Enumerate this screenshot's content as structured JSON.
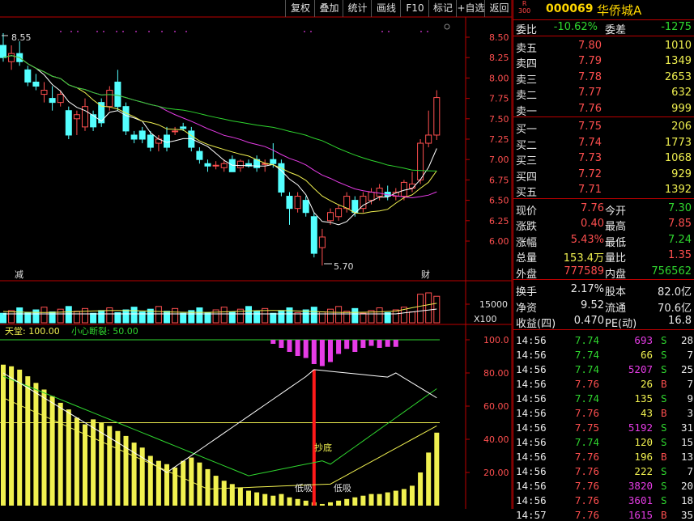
{
  "toolbar": {
    "buttons": [
      "复权",
      "叠加",
      "统计",
      "画线",
      "F10",
      "标记",
      "+自选",
      "返回"
    ]
  },
  "stock": {
    "badge_r": "R",
    "badge_300": "300",
    "code": "000069",
    "name": "华侨城A"
  },
  "price_chart": {
    "y_ticks": [
      "8.50",
      "8.25",
      "8.00",
      "7.75",
      "7.50",
      "7.25",
      "7.00",
      "6.75",
      "6.50",
      "6.25",
      "6.00"
    ],
    "high_label": "8.55",
    "low_label": "5.70",
    "marker_left": "减",
    "marker_right": "财",
    "ylim": [
      5.7,
      8.55
    ]
  },
  "volume_chart": {
    "tick": "15000",
    "unit": "X100"
  },
  "indicator": {
    "legend_a": "天堂: 100.00",
    "legend_b": "小心断裂: 50.00",
    "y_ticks": [
      "100.0",
      "80.00",
      "60.00",
      "40.00",
      "20.00"
    ],
    "label_bottom": "抄底",
    "label_low1": "低吸",
    "label_low2": "低吸"
  },
  "chart_data": {
    "type": "candlestick",
    "title": "",
    "ylim": [
      5.7,
      8.55
    ],
    "candles": [
      {
        "o": 8.4,
        "h": 8.55,
        "l": 8.2,
        "c": 8.25
      },
      {
        "o": 8.2,
        "h": 8.4,
        "l": 8.1,
        "c": 8.3
      },
      {
        "o": 8.3,
        "h": 8.45,
        "l": 8.15,
        "c": 8.2
      },
      {
        "o": 8.1,
        "h": 8.15,
        "l": 7.9,
        "c": 7.95
      },
      {
        "o": 7.95,
        "h": 8.05,
        "l": 7.85,
        "c": 7.9
      },
      {
        "o": 7.8,
        "h": 7.95,
        "l": 7.7,
        "c": 7.85
      },
      {
        "o": 7.75,
        "h": 7.9,
        "l": 7.6,
        "c": 7.7
      },
      {
        "o": 7.7,
        "h": 7.85,
        "l": 7.65,
        "c": 7.8
      },
      {
        "o": 7.6,
        "h": 7.65,
        "l": 7.25,
        "c": 7.3
      },
      {
        "o": 7.5,
        "h": 7.6,
        "l": 7.3,
        "c": 7.55
      },
      {
        "o": 7.4,
        "h": 7.75,
        "l": 7.35,
        "c": 7.65
      },
      {
        "o": 7.55,
        "h": 7.6,
        "l": 7.35,
        "c": 7.4
      },
      {
        "o": 7.7,
        "h": 7.75,
        "l": 7.4,
        "c": 7.45
      },
      {
        "o": 7.65,
        "h": 7.9,
        "l": 7.6,
        "c": 7.85
      },
      {
        "o": 7.95,
        "h": 8.1,
        "l": 7.6,
        "c": 7.65
      },
      {
        "o": 7.65,
        "h": 7.7,
        "l": 7.3,
        "c": 7.35
      },
      {
        "o": 7.3,
        "h": 7.35,
        "l": 7.2,
        "c": 7.25
      },
      {
        "o": 7.35,
        "h": 7.4,
        "l": 7.2,
        "c": 7.25
      },
      {
        "o": 7.3,
        "h": 7.35,
        "l": 7.1,
        "c": 7.15
      },
      {
        "o": 7.2,
        "h": 7.3,
        "l": 7.1,
        "c": 7.25
      },
      {
        "o": 7.3,
        "h": 7.4,
        "l": 7.1,
        "c": 7.15
      },
      {
        "o": 7.35,
        "h": 7.4,
        "l": 7.3,
        "c": 7.35
      },
      {
        "o": 7.4,
        "h": 7.45,
        "l": 7.35,
        "c": 7.38
      },
      {
        "o": 7.35,
        "h": 7.4,
        "l": 7.1,
        "c": 7.15
      },
      {
        "o": 7.1,
        "h": 7.15,
        "l": 6.95,
        "c": 7.0
      },
      {
        "o": 6.95,
        "h": 7.0,
        "l": 6.85,
        "c": 6.92
      },
      {
        "o": 6.92,
        "h": 6.98,
        "l": 6.88,
        "c": 6.93
      },
      {
        "o": 6.9,
        "h": 7.0,
        "l": 6.85,
        "c": 6.95
      },
      {
        "o": 7.0,
        "h": 7.05,
        "l": 6.85,
        "c": 6.85
      },
      {
        "o": 6.9,
        "h": 7.0,
        "l": 6.85,
        "c": 6.98
      },
      {
        "o": 6.95,
        "h": 7.0,
        "l": 6.9,
        "c": 6.92
      },
      {
        "o": 7.0,
        "h": 7.05,
        "l": 6.85,
        "c": 6.9
      },
      {
        "o": 6.95,
        "h": 7.0,
        "l": 6.85,
        "c": 6.95
      },
      {
        "o": 7.0,
        "h": 7.2,
        "l": 6.9,
        "c": 6.95
      },
      {
        "o": 6.95,
        "h": 7.0,
        "l": 6.55,
        "c": 6.6
      },
      {
        "o": 6.55,
        "h": 6.6,
        "l": 6.2,
        "c": 6.4
      },
      {
        "o": 6.4,
        "h": 6.6,
        "l": 6.35,
        "c": 6.55
      },
      {
        "o": 6.5,
        "h": 6.55,
        "l": 6.3,
        "c": 6.35
      },
      {
        "o": 6.3,
        "h": 6.35,
        "l": 5.8,
        "c": 5.85
      },
      {
        "o": 5.92,
        "h": 6.15,
        "l": 5.7,
        "c": 6.05
      },
      {
        "o": 6.25,
        "h": 6.4,
        "l": 6.2,
        "c": 6.35
      },
      {
        "o": 6.3,
        "h": 6.45,
        "l": 6.25,
        "c": 6.4
      },
      {
        "o": 6.4,
        "h": 6.6,
        "l": 6.35,
        "c": 6.55
      },
      {
        "o": 6.5,
        "h": 6.55,
        "l": 6.3,
        "c": 6.35
      },
      {
        "o": 6.4,
        "h": 6.6,
        "l": 6.35,
        "c": 6.55
      },
      {
        "o": 6.5,
        "h": 6.65,
        "l": 6.45,
        "c": 6.6
      },
      {
        "o": 6.55,
        "h": 6.7,
        "l": 6.5,
        "c": 6.65
      },
      {
        "o": 6.6,
        "h": 6.68,
        "l": 6.5,
        "c": 6.55
      },
      {
        "o": 6.55,
        "h": 6.65,
        "l": 6.5,
        "c": 6.6
      },
      {
        "o": 6.55,
        "h": 6.75,
        "l": 6.5,
        "c": 6.72
      },
      {
        "o": 6.65,
        "h": 6.85,
        "l": 6.6,
        "c": 6.7
      },
      {
        "o": 6.75,
        "h": 7.25,
        "l": 6.7,
        "c": 7.2
      },
      {
        "o": 7.2,
        "h": 7.6,
        "l": 7.15,
        "c": 7.3
      },
      {
        "o": 7.3,
        "h": 7.85,
        "l": 7.24,
        "c": 7.76
      }
    ]
  },
  "quote": {
    "weibi_label": "委比",
    "weibi_value": "-10.62%",
    "weicha_label": "委差",
    "weicha_value": "-1275",
    "sells": [
      {
        "label": "卖五",
        "price": "7.80",
        "vol": "1010"
      },
      {
        "label": "卖四",
        "price": "7.79",
        "vol": "1349"
      },
      {
        "label": "卖三",
        "price": "7.78",
        "vol": "2653"
      },
      {
        "label": "卖二",
        "price": "7.77",
        "vol": "632"
      },
      {
        "label": "卖一",
        "price": "7.76",
        "vol": "999"
      }
    ],
    "buys": [
      {
        "label": "买一",
        "price": "7.75",
        "vol": "206"
      },
      {
        "label": "买二",
        "price": "7.74",
        "vol": "1773"
      },
      {
        "label": "买三",
        "price": "7.73",
        "vol": "1068"
      },
      {
        "label": "买四",
        "price": "7.72",
        "vol": "929"
      },
      {
        "label": "买五",
        "price": "7.71",
        "vol": "1392"
      }
    ],
    "stats": [
      {
        "l1": "现价",
        "v1": "7.76",
        "c1": "red",
        "l2": "今开",
        "v2": "7.30",
        "c2": "green"
      },
      {
        "l1": "涨跌",
        "v1": "0.40",
        "c1": "red",
        "l2": "最高",
        "v2": "7.85",
        "c2": "red"
      },
      {
        "l1": "涨幅",
        "v1": "5.43%",
        "c1": "red",
        "l2": "最低",
        "v2": "7.24",
        "c2": "green"
      },
      {
        "l1": "总量",
        "v1": "153.4万",
        "c1": "yellow",
        "l2": "量比",
        "v2": "1.35",
        "c2": "red"
      },
      {
        "l1": "外盘",
        "v1": "777589",
        "c1": "red",
        "l2": "内盘",
        "v2": "756562",
        "c2": "green"
      }
    ],
    "stats2": [
      {
        "l1": "换手",
        "v1": "2.17%",
        "l2": "股本",
        "v2": "82.0亿"
      },
      {
        "l1": "净资",
        "v1": "9.52",
        "l2": "流通",
        "v2": "70.6亿"
      },
      {
        "l1": "收益(四)",
        "v1": "0.470",
        "l2": "PE(动)",
        "v2": "16.8"
      }
    ]
  },
  "ticks": [
    {
      "t": "14:56",
      "p": "7.74",
      "pc": "green",
      "v": "693",
      "vc": "magenta",
      "s": "S",
      "n": "28"
    },
    {
      "t": "14:56",
      "p": "7.74",
      "pc": "green",
      "v": "66",
      "vc": "yellow",
      "s": "S",
      "n": "7"
    },
    {
      "t": "14:56",
      "p": "7.74",
      "pc": "green",
      "v": "5207",
      "vc": "magenta",
      "s": "S",
      "n": "25"
    },
    {
      "t": "14:56",
      "p": "7.76",
      "pc": "red",
      "v": "26",
      "vc": "yellow",
      "s": "B",
      "n": "7"
    },
    {
      "t": "14:56",
      "p": "7.74",
      "pc": "green",
      "v": "135",
      "vc": "yellow",
      "s": "S",
      "n": "9"
    },
    {
      "t": "14:56",
      "p": "7.76",
      "pc": "red",
      "v": "43",
      "vc": "yellow",
      "s": "B",
      "n": "3"
    },
    {
      "t": "14:56",
      "p": "7.75",
      "pc": "red",
      "v": "5192",
      "vc": "magenta",
      "s": "S",
      "n": "31"
    },
    {
      "t": "14:56",
      "p": "7.74",
      "pc": "green",
      "v": "120",
      "vc": "yellow",
      "s": "S",
      "n": "15"
    },
    {
      "t": "14:56",
      "p": "7.76",
      "pc": "red",
      "v": "196",
      "vc": "yellow",
      "s": "B",
      "n": "13"
    },
    {
      "t": "14:56",
      "p": "7.76",
      "pc": "red",
      "v": "222",
      "vc": "yellow",
      "s": "S",
      "n": "7"
    },
    {
      "t": "14:56",
      "p": "7.76",
      "pc": "red",
      "v": "3820",
      "vc": "magenta",
      "s": "S",
      "n": "20"
    },
    {
      "t": "14:56",
      "p": "7.76",
      "pc": "red",
      "v": "3601",
      "vc": "magenta",
      "s": "S",
      "n": "18"
    },
    {
      "t": "14:57",
      "p": "7.76",
      "pc": "red",
      "v": "1615",
      "vc": "magenta",
      "s": "B",
      "n": "35"
    }
  ]
}
